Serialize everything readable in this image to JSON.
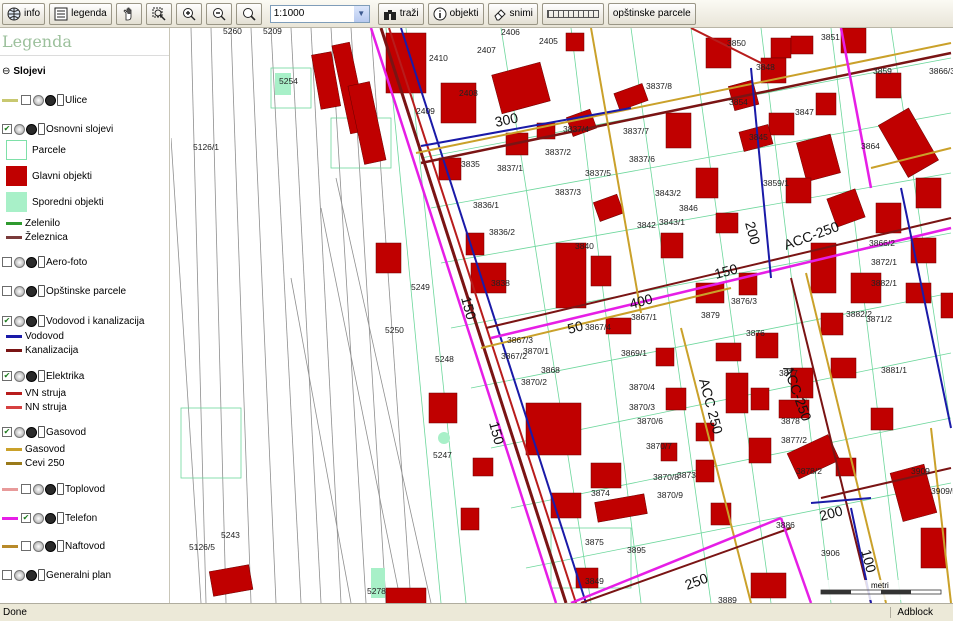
{
  "toolbar": {
    "info_label": "info",
    "legenda_label": "legenda",
    "pan_icon": "hand-icon",
    "zoom_box_icon": "zoom-box-icon",
    "zoom_in_icon": "zoom-in-icon",
    "zoom_out_icon": "zoom-out-icon",
    "zoom_full_icon": "magnifier-icon",
    "scale_value": "1:1000",
    "trazi_label": "traži",
    "objekti_label": "objekti",
    "snimi_label": "snimi",
    "measure_icon": "ruler-icon",
    "opstinske_label": "opštinske parcele"
  },
  "legend": {
    "title": "Legenda",
    "slojevi": "Slojevi",
    "ulice": "Ulice",
    "osnovni": "Osnovni slojevi",
    "parcele": "Parcele",
    "glavni": "Glavni objekti",
    "sporedni": "Sporedni objekti",
    "zelenilo": "Zelenilo",
    "zeleznica": "Železnica",
    "aerofoto": "Aero-foto",
    "opstinske": "Opštinske parcele",
    "vodovod_kan": "Vodovod i kanalizacija",
    "vodovod": "Vodovod",
    "kanalizacija": "Kanalizacija",
    "elektrika": "Elektrika",
    "vn": "VN struja",
    "nn": "NN struja",
    "gasovod": "Gasovod",
    "gasovod2": "Gasovod",
    "cevi": "Cevi 250",
    "toplovod": "Toplovod",
    "telefon": "Telefon",
    "naftovod": "Naftovod",
    "generalni": "Generalni plan",
    "colors": {
      "ulice": "#c8c870",
      "zelenilo": "#2f9a2f",
      "zeleznica": "#7a3b3b",
      "vodovod": "#1a1aa8",
      "kanalizacija": "#7a1414",
      "vn": "#b81c1c",
      "nn": "#d64040",
      "gasovod": "#caa12a",
      "cevi": "#9a7a1a",
      "toplovod": "#e89a9a",
      "telefon": "#e61ee6",
      "naftovod": "#b88a2a",
      "glavni": "#c00000",
      "sporedni": "#a8f0c8"
    }
  },
  "map": {
    "parcel_labels": [
      "5260",
      "5209",
      "5254",
      "5126/1",
      "5249",
      "5250",
      "5248",
      "5247",
      "5126/5",
      "5243",
      "5278",
      "2410",
      "2407",
      "2406",
      "2405",
      "2409",
      "2408",
      "3837/8",
      "3837/4",
      "3837/7",
      "3837/2",
      "3837/6",
      "3835",
      "3837/1",
      "3837/5",
      "3837/3",
      "3836/1",
      "3843/2",
      "3843/1",
      "3836/2",
      "3842",
      "3840",
      "3838",
      "3867/4",
      "3867/1",
      "3867/2",
      "3867/3",
      "3870/1",
      "3869/1",
      "3868",
      "3870/2",
      "3870/4",
      "3870/3",
      "3870/6",
      "3870/7",
      "3870/8",
      "3870/9",
      "3873",
      "3874",
      "3875",
      "3895",
      "3849",
      "3850",
      "3851",
      "3848",
      "3854",
      "3847",
      "3845",
      "3859/1",
      "3859",
      "3866/3",
      "3866/2",
      "3872/1",
      "3876/3",
      "3879",
      "3882/2",
      "3882/1",
      "3871/2",
      "3876",
      "3881/1",
      "3877",
      "3878",
      "3877/2",
      "3878/2",
      "3909",
      "3909/5",
      "3886",
      "3906",
      "3889",
      "3864",
      "3846"
    ],
    "utility_labels": [
      "300",
      "150",
      "400",
      "200",
      "ACC-250",
      "ACC-250",
      "ACC 250",
      "150",
      "150",
      "50",
      "200",
      "100",
      "250"
    ],
    "scalebar_label": "metri"
  },
  "status": {
    "left": "Done",
    "right": "Adblock"
  }
}
